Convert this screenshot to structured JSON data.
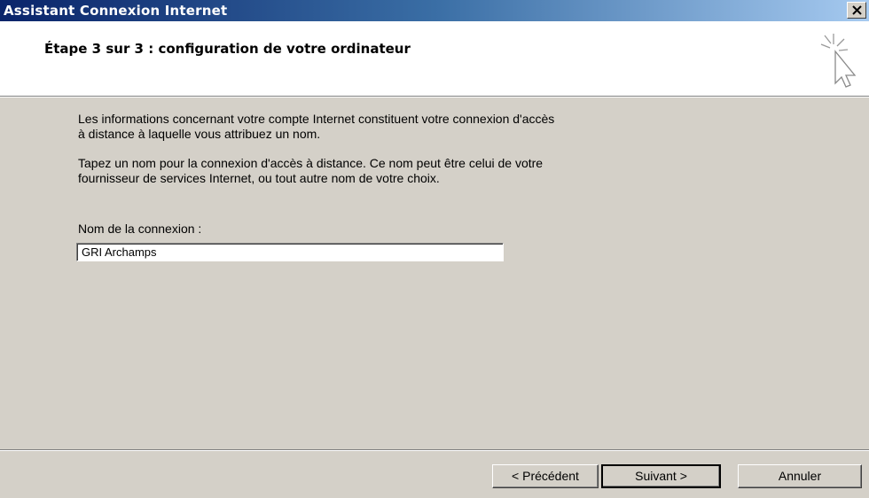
{
  "window": {
    "title": "Assistant Connexion Internet",
    "close_label": "X"
  },
  "header": {
    "step_title": "Étape 3 sur 3 : configuration de votre ordinateur",
    "icon": "wizard-cursor-sparkle-icon"
  },
  "body": {
    "paragraph1_line1": "Les informations concernant votre compte Internet constituent votre connexion d'accès",
    "paragraph1_line2": "à distance à laquelle vous attribuez un nom.",
    "paragraph2_line1": "Tapez un nom pour la connexion d'accès à distance. Ce nom peut être celui de votre",
    "paragraph2_line2": "fournisseur de services Internet, ou tout autre nom de votre choix.",
    "field_label": "Nom de la connexion :",
    "field_value": "GRI Archamps"
  },
  "buttons": {
    "previous": "< Précédent",
    "next": "Suivant >",
    "cancel": "Annuler"
  },
  "colors": {
    "titlebar_start": "#0a246a",
    "titlebar_end": "#a6caf0",
    "face": "#d4d0c8"
  }
}
